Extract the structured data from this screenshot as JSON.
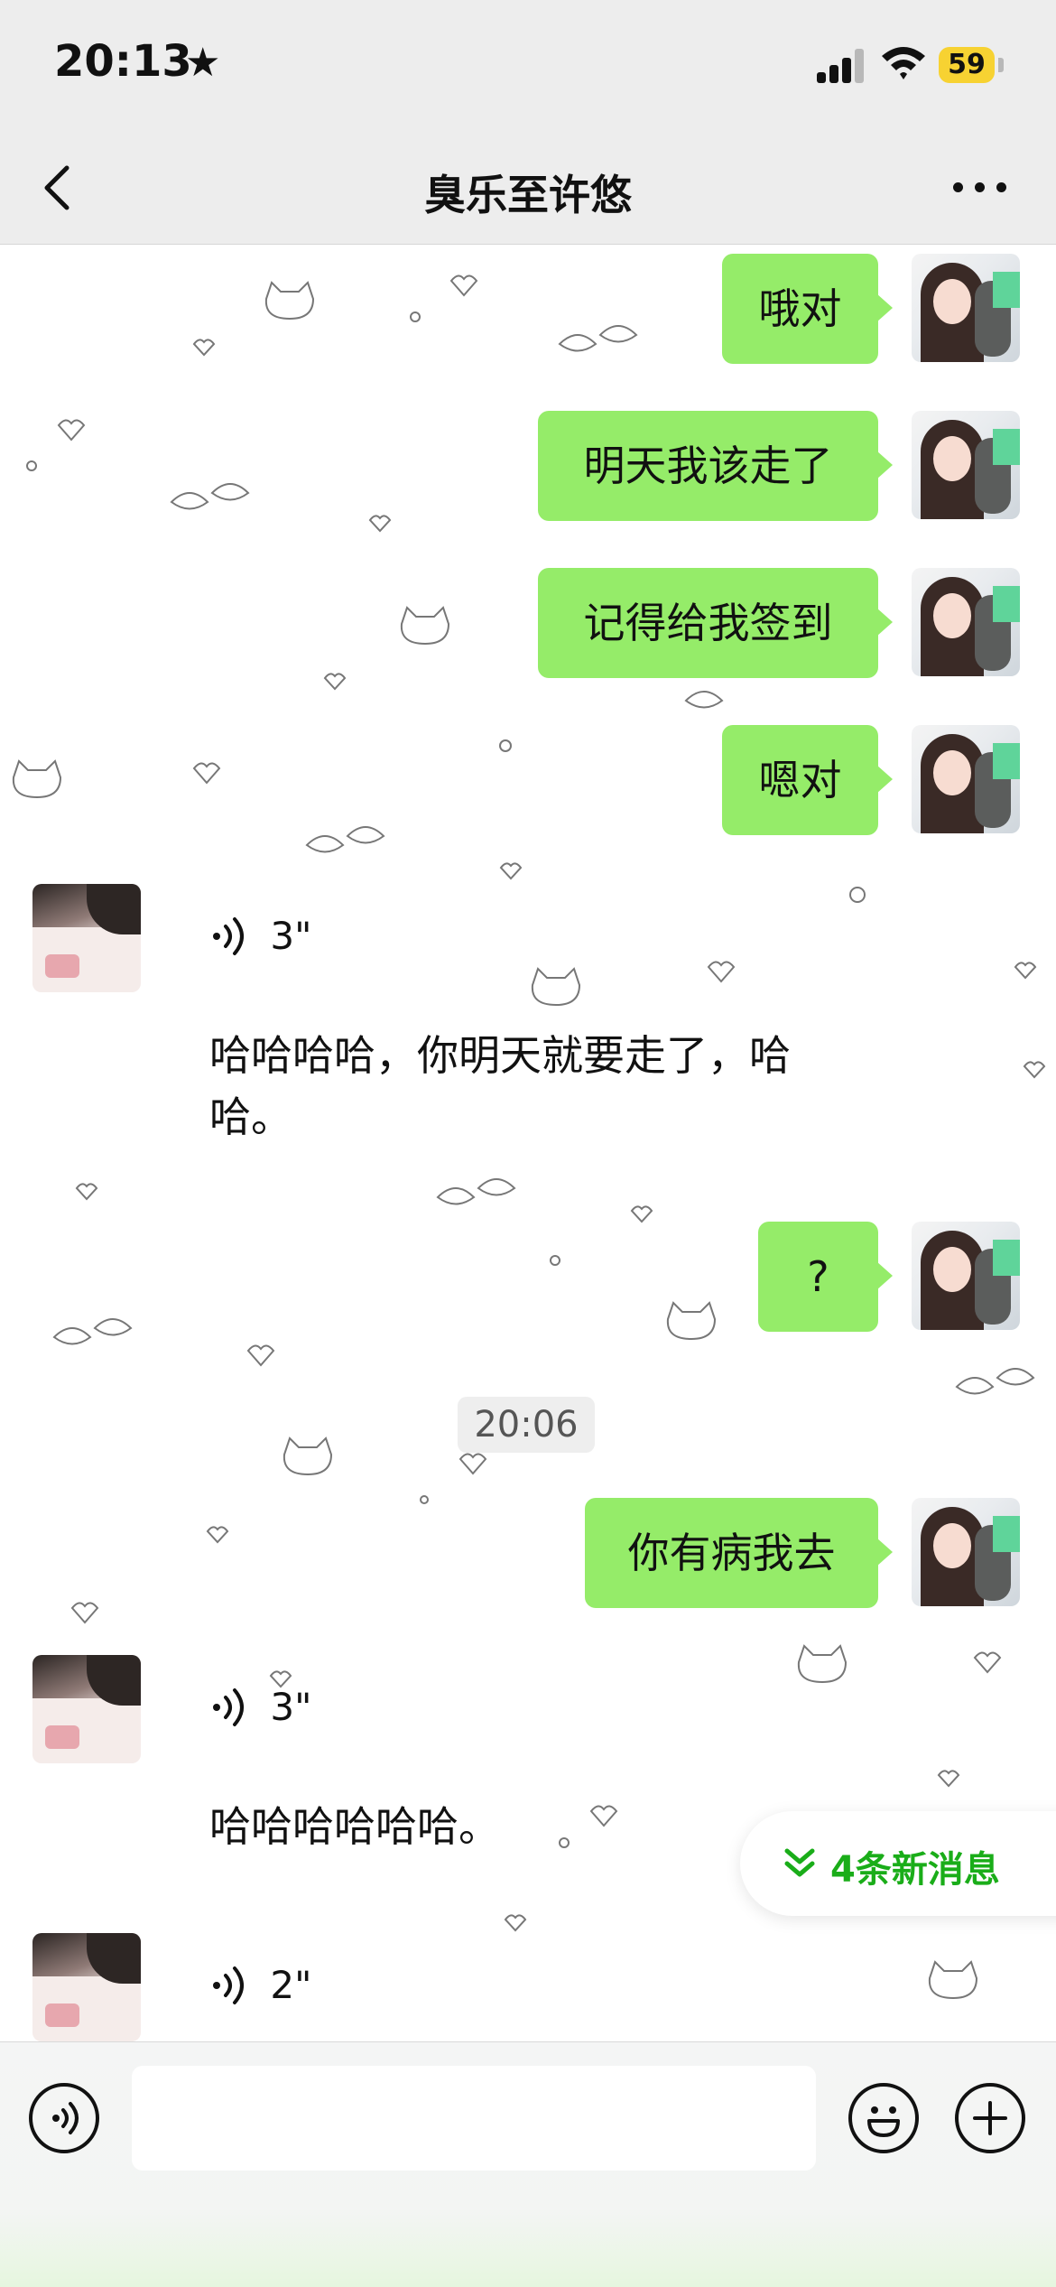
{
  "status_bar": {
    "time": "20:13",
    "battery": "59"
  },
  "header": {
    "title": "臭乐至许悠"
  },
  "messages": {
    "out_1": "哦对",
    "out_2": "明天我该走了",
    "out_3": "记得给我签到",
    "out_4": "嗯对",
    "voice_1_duration": "3\"",
    "voice_1_transcript": "哈哈哈哈，你明天就要走了，哈哈。",
    "out_5": "?",
    "timestamp": "20:06",
    "out_6": "你有病我去",
    "voice_2_duration": "3\"",
    "voice_2_transcript": "哈哈哈哈哈哈。",
    "voice_3_duration": "2\""
  },
  "new_messages": {
    "label": "4条新消息"
  },
  "input": {
    "value": "",
    "placeholder": ""
  },
  "colors": {
    "bubble_out": "#95ec69",
    "accent_green": "#1aad19",
    "bar_bg": "#ededed"
  }
}
